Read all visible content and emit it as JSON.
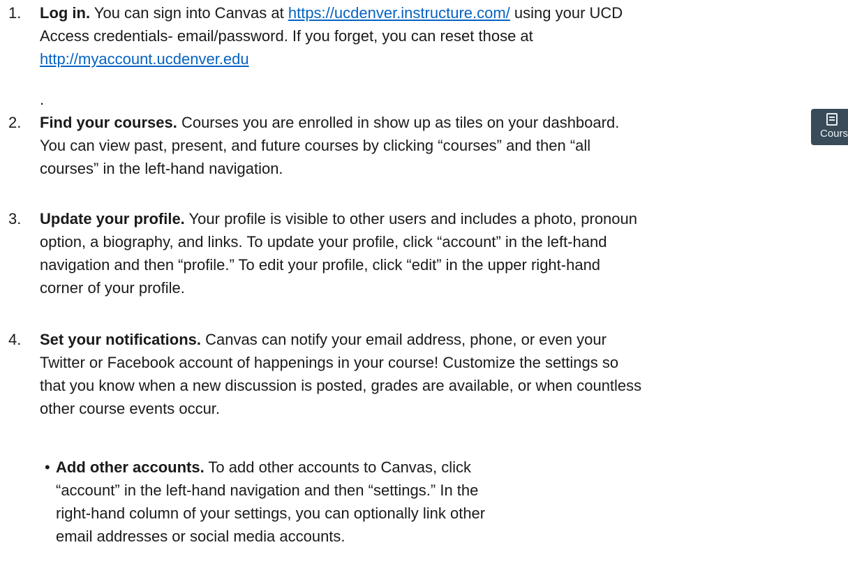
{
  "items": [
    {
      "number": "1.",
      "lead": "Log in.",
      "line1_pre": " You can sign into Canvas at ",
      "line1_link": "https://ucdenver.instructure.com/",
      "line1_post": " using your UCD",
      "line2": "Access credentials- email/password. If you forget, you can reset those at",
      "line3_link": "http://myaccount.ucdenver.edu",
      "trailing": "."
    },
    {
      "number": "2.",
      "lead": "Find your courses.",
      "line1_post": " Courses you are enrolled in show up as tiles on your dashboard.",
      "line2": "You can view past, present, and future courses by clicking “courses” and then “all",
      "line3": "courses” in the left-hand navigation."
    },
    {
      "number": "3.",
      "lead": "Update your profile.",
      "line1_post": " Your profile is visible to other users and includes a photo, pronoun",
      "line2": "option, a biography, and links. To update your profile, click “account” in the left-hand",
      "line3": "navigation and then “profile.” To edit your profile, click “edit” in the upper right-hand",
      "line4": "corner of your profile."
    },
    {
      "number": "4.",
      "lead": "Set your notifications.",
      "line1_post": " Canvas can notify your email address, phone, or even your",
      "line2": "Twitter or Facebook account of happenings in your course! Customize the settings so",
      "line3": "that you know when a new discussion is posted, grades are available, or when countless",
      "line4": "other course events occur."
    }
  ],
  "bullet": {
    "symbol": "•",
    "lead": "Add other accounts.",
    "line1_post": " To add other accounts to Canvas, click",
    "line2": "“account” in the left-hand navigation and then “settings.” In the",
    "line3": "right-hand column of your settings, you can optionally link other",
    "line4": "email addresses or social media accounts."
  },
  "courses_tile": {
    "icon": "courses-book-icon",
    "label": "Courses",
    "bg_color": "#394b58"
  },
  "colors": {
    "link": "#0563c1",
    "text": "#1a1a1a"
  }
}
